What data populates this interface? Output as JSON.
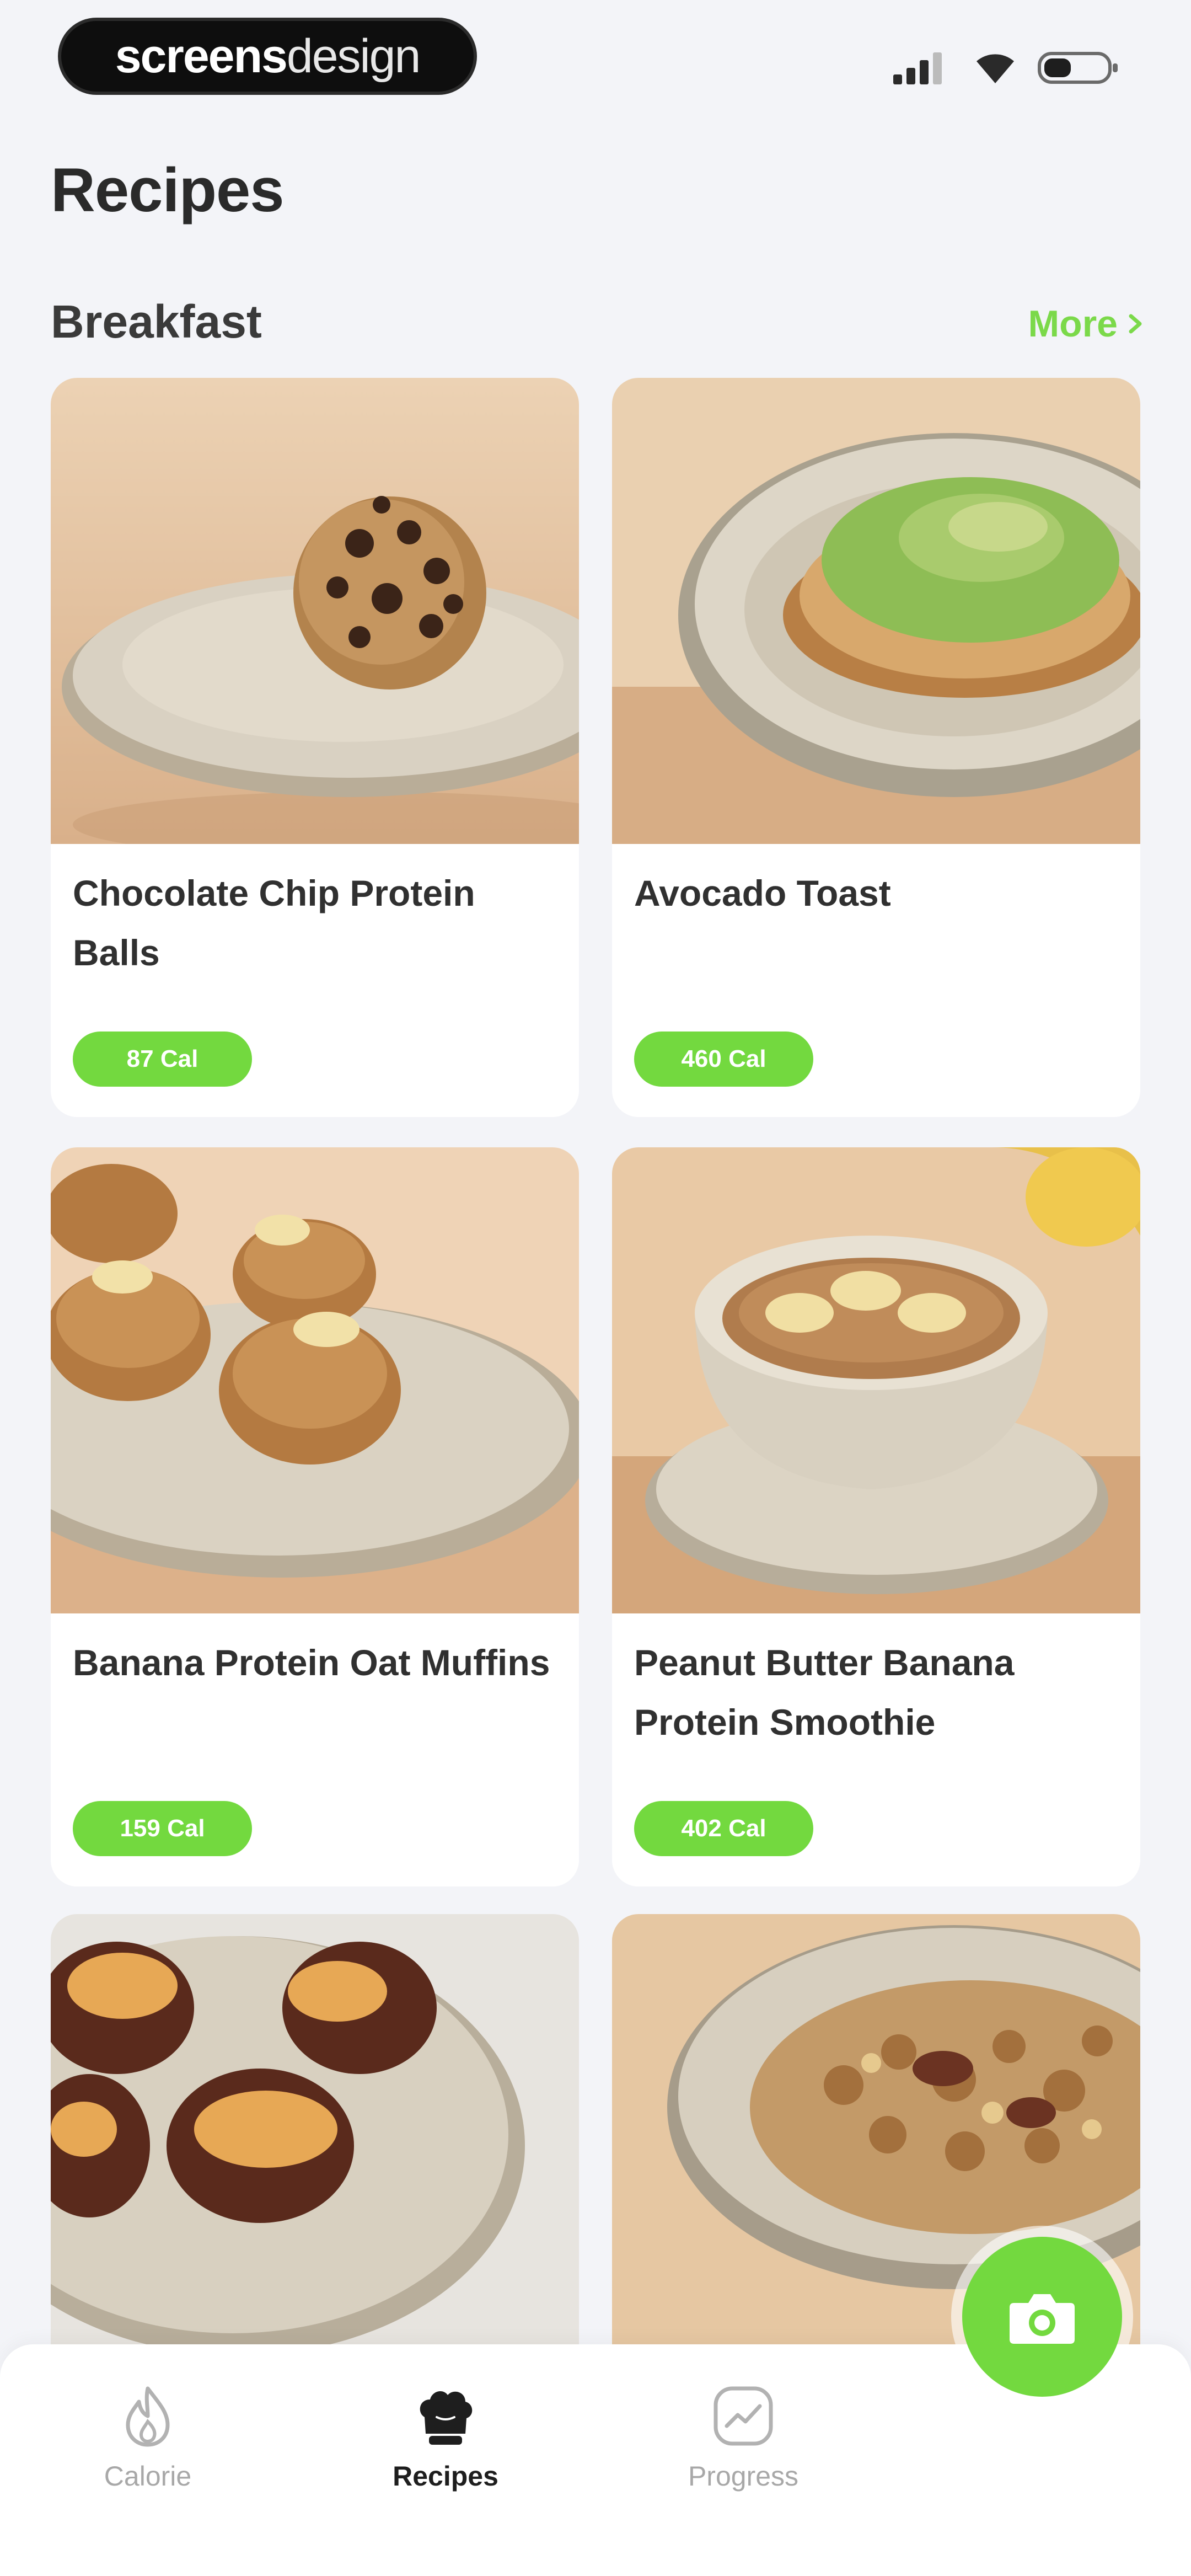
{
  "status_bar": {
    "brand_bold": "screens",
    "brand_light": "design",
    "signal_icon": "cellular-signal-icon",
    "wifi_icon": "wifi-icon",
    "battery_icon": "battery-icon"
  },
  "page": {
    "title": "Recipes"
  },
  "section": {
    "title": "Breakfast",
    "more_label": "More",
    "more_icon": "chevron-right-icon"
  },
  "recipes": [
    {
      "name": "Chocolate Chip Protein Balls",
      "calories": "87 Cal"
    },
    {
      "name": "Avocado Toast",
      "calories": "460 Cal"
    },
    {
      "name": "Banana Protein Oat Muffins",
      "calories": "159 Cal"
    },
    {
      "name": "Peanut Butter Banana Protein Smoothie",
      "calories": "402 Cal"
    }
  ],
  "tab_bar": {
    "tabs": [
      {
        "label": "Calorie",
        "icon": "flame-icon"
      },
      {
        "label": "Recipes",
        "icon": "chef-hat-icon",
        "active": true
      },
      {
        "label": "Progress",
        "icon": "chart-icon"
      }
    ]
  },
  "fab": {
    "icon": "camera-icon"
  },
  "colors": {
    "accent": "#73d93f",
    "more_link": "#7bd94a",
    "background": "#f3f4f8",
    "card": "#ffffff",
    "title": "#2a2a2a"
  }
}
